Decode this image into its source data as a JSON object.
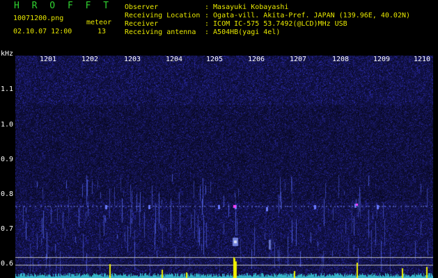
{
  "header": {
    "title": "H R O F F T",
    "filename": "10071200.png",
    "datetime": "02.10.07 12:00",
    "meteor_label": "meteor",
    "meteor_count": "13",
    "fields": [
      {
        "label": "Observer",
        "value": ": Masayuki Kobayashi"
      },
      {
        "label": "Receiving Location",
        "value": ": Ogata-vill. Akita-Pref. JAPAN (139.96E, 40.02N)"
      },
      {
        "label": "Receiver",
        "value": ": ICOM IC-575 53.7492(@LCD)MHz USB"
      },
      {
        "label": "Receiving antenna",
        "value": ": A504HB(yagi 4el)"
      }
    ]
  },
  "spectrogram": {
    "y_unit": "kHz",
    "y_ticks": [
      "1.1",
      "1.0",
      "0.9",
      "0.8",
      "0.7",
      "0.6"
    ],
    "x_ticks": [
      "1201",
      "1202",
      "1203",
      "1204",
      "1205",
      "1206",
      "1207",
      "1208",
      "1209",
      "1210"
    ]
  },
  "chart_data": {
    "type": "heatmap",
    "title": "",
    "xlabel": "",
    "ylabel": "kHz",
    "x_ticks": [
      1201,
      1202,
      1203,
      1204,
      1205,
      1206,
      1207,
      1208,
      1209,
      1210
    ],
    "y_ticks": [
      1.1,
      1.0,
      0.9,
      0.8,
      0.7,
      0.6
    ],
    "ylim": [
      0.58,
      1.17
    ],
    "colors": {
      "background": "#000010",
      "noise": "#1a1a90",
      "signal": "#e8e800",
      "echo_core": "#ff40ff"
    }
  }
}
